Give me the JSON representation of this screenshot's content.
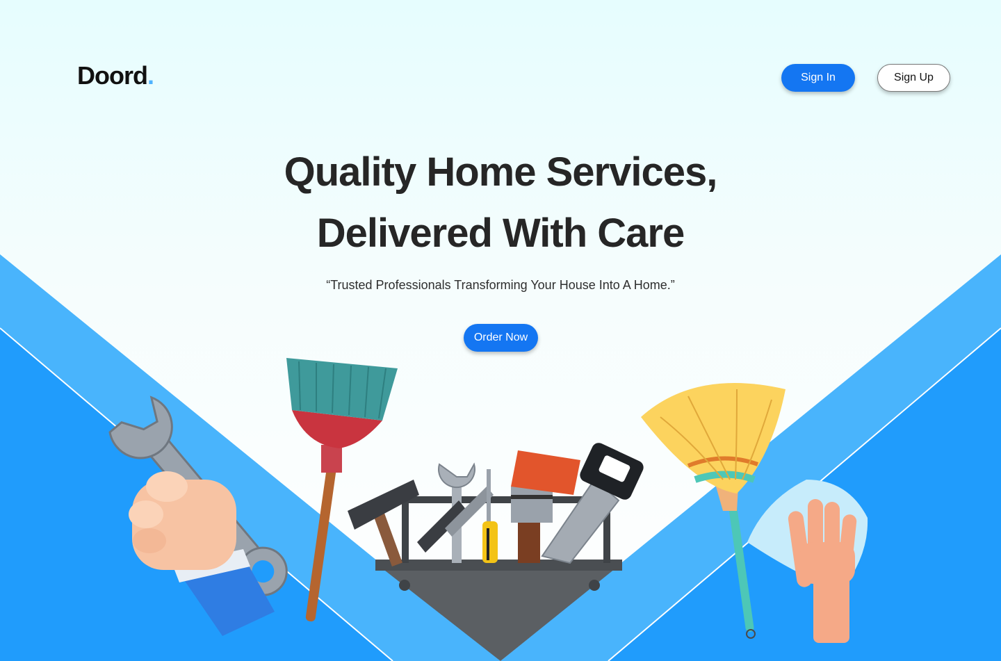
{
  "brand": {
    "name": "Doord",
    "dot": "."
  },
  "header": {
    "sign_in": "Sign In",
    "sign_up": "Sign Up"
  },
  "hero": {
    "title_line1": "Quality Home Services,",
    "title_line2": "Delivered With Care",
    "tagline": "“Trusted Professionals Transforming Your House Into A Home.”",
    "cta": "Order Now"
  },
  "colors": {
    "accent": "#1476f2",
    "band_light": "#49b4fc",
    "band_dark": "#209cfc",
    "logo_dot": "#4fb3ff"
  },
  "illustrations": [
    "hand-wrench-icon",
    "broom-icon",
    "toolbox-icon",
    "feather-duster-icon",
    "cleaning-cloth-hand-icon"
  ]
}
